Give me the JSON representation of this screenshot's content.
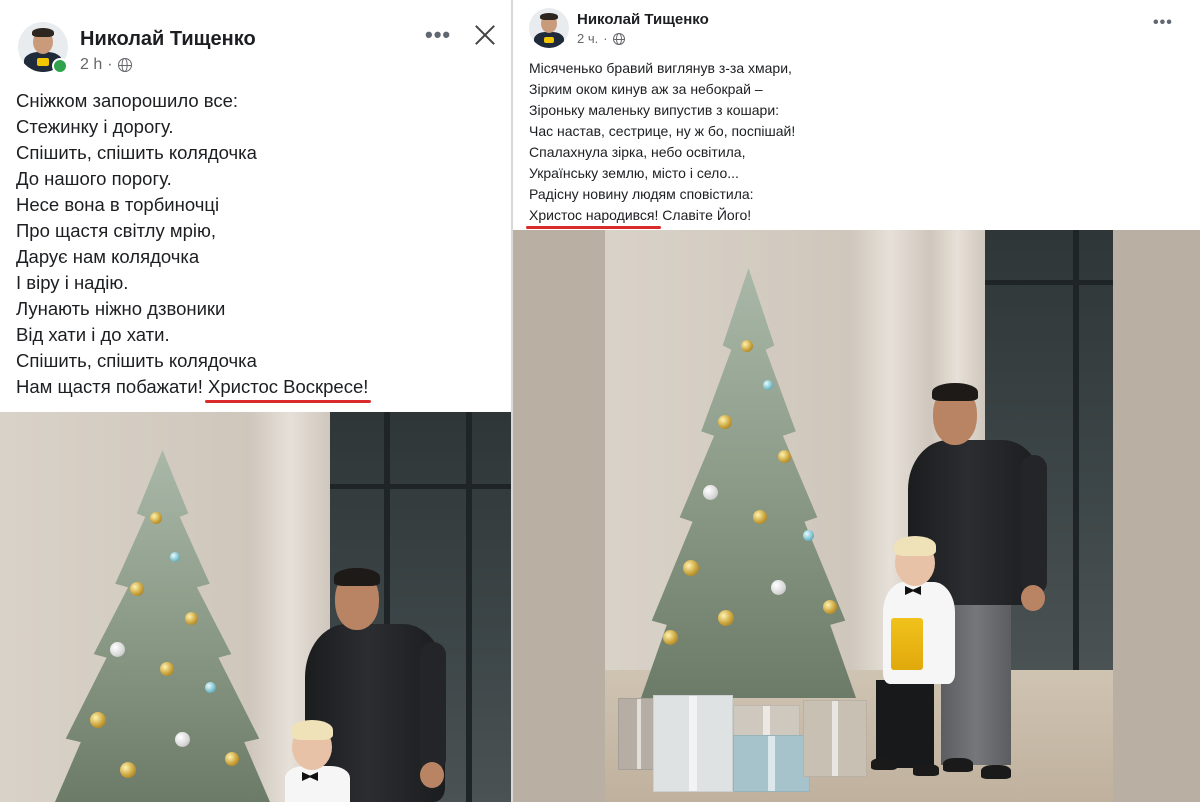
{
  "left_post": {
    "author": "Николай Тищенко",
    "time": "2 h",
    "poem": [
      "Сніжком запорошило все:",
      "Стежинку і дорогу.",
      "Спішить, спішить колядочка",
      "До нашого порогу.",
      "Несе вона в торбиночці",
      "Про щастя світлу мрію,",
      "Дарує нам колядочка",
      "І віру і надію.",
      "Лунають ніжно дзвоники",
      "Від хати і до хати.",
      "Спішить, спішить колядочка"
    ],
    "last_line_prefix": "Нам щастя побажати! ",
    "last_line_highlight": "Христос Воскресе!"
  },
  "right_post": {
    "author": "Николай Тищенко",
    "time": "2 ч.",
    "poem": [
      "Місяченько бравий виглянув з-за хмари,",
      "Зірким оком кинув аж за небокрай –",
      "Зіроньку маленьку випустив з кошари:",
      "Час настав, сестрице, ну ж бо, поспішай!",
      "Спалахнула зірка, небо освітила,",
      "Українську землю, місто і село...",
      "Радісну новину людям сповістила:"
    ],
    "last_line_highlight": "Христос народився!",
    "last_line_suffix": " Славіте Його!"
  },
  "icons": {
    "more": "more-options-icon",
    "close": "close-icon",
    "audience": "globe-icon"
  },
  "colors": {
    "highlight_underline": "#d92b2b",
    "online": "#31a24c",
    "meta_text": "#65676b"
  }
}
